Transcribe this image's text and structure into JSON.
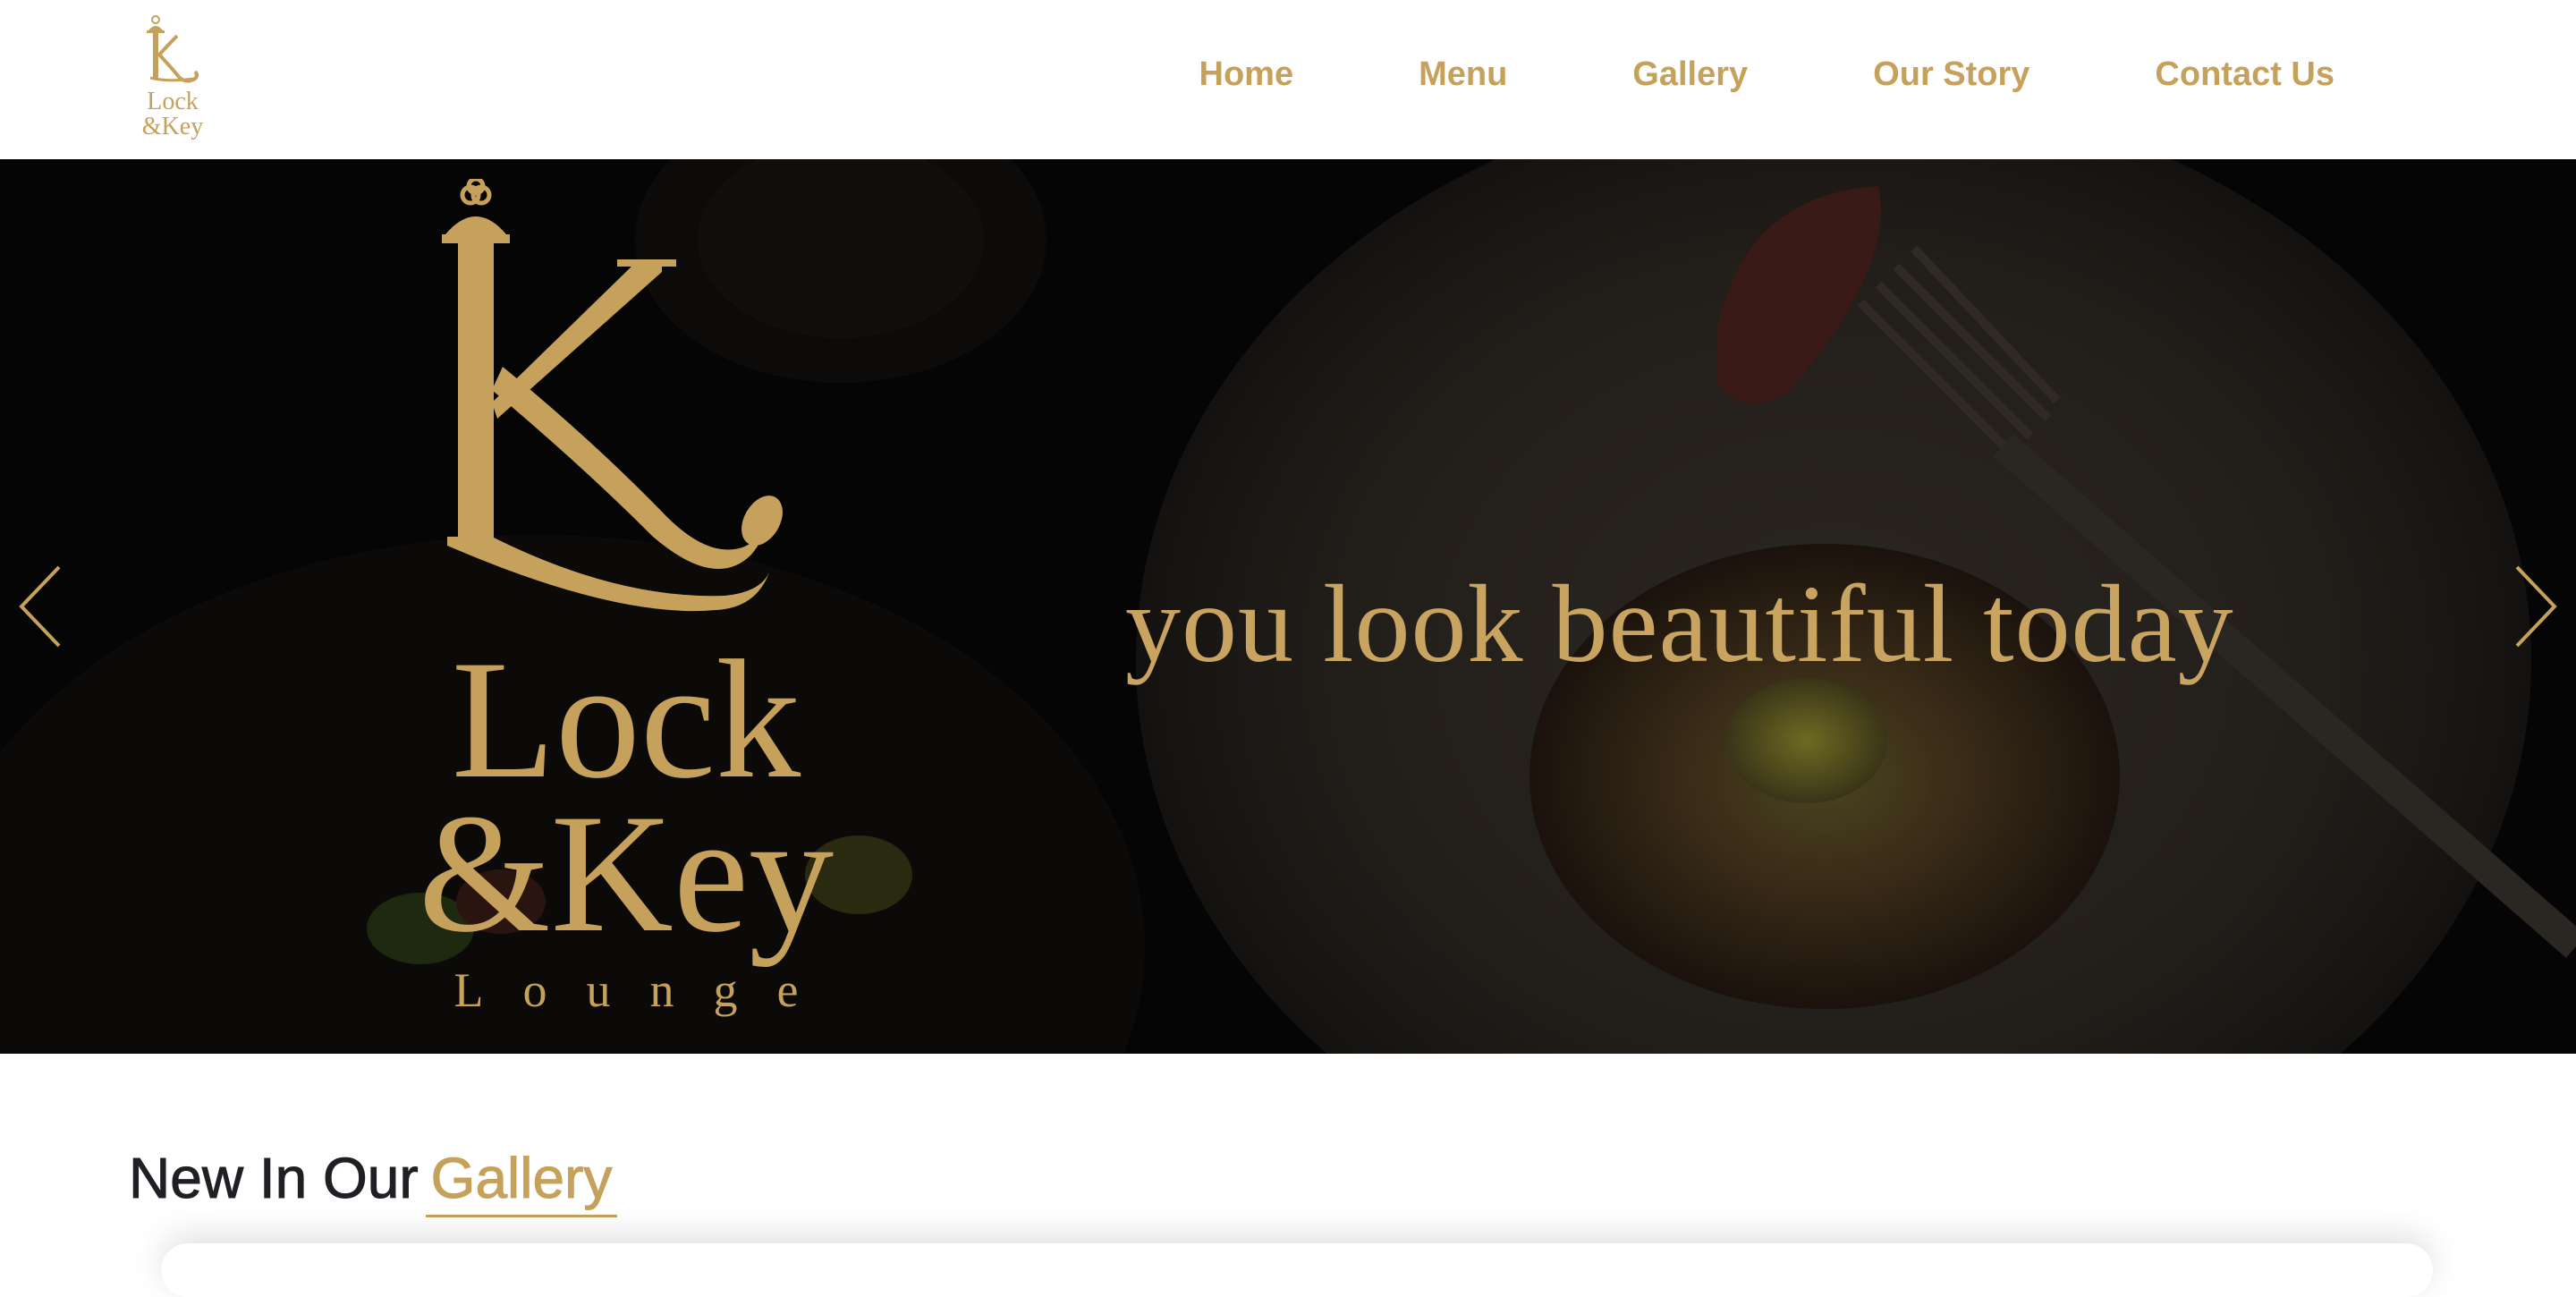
{
  "brand": {
    "logo_line1": "Lock",
    "logo_line2": "&Key",
    "wordmark_line1": "Lock",
    "wordmark_line2": "&Key",
    "wordmark_line3": "Lounge",
    "color": "#c6a15b"
  },
  "nav": {
    "items": [
      {
        "label": "Home"
      },
      {
        "label": "Menu"
      },
      {
        "label": "Gallery"
      },
      {
        "label": "Our Story"
      },
      {
        "label": "Contact Us"
      }
    ]
  },
  "hero": {
    "tagline": "you look beautiful today",
    "prev_icon": "chevron-left-icon",
    "next_icon": "chevron-right-icon"
  },
  "gallery": {
    "heading_prefix": "New In Our",
    "heading_accent": "Gallery"
  }
}
